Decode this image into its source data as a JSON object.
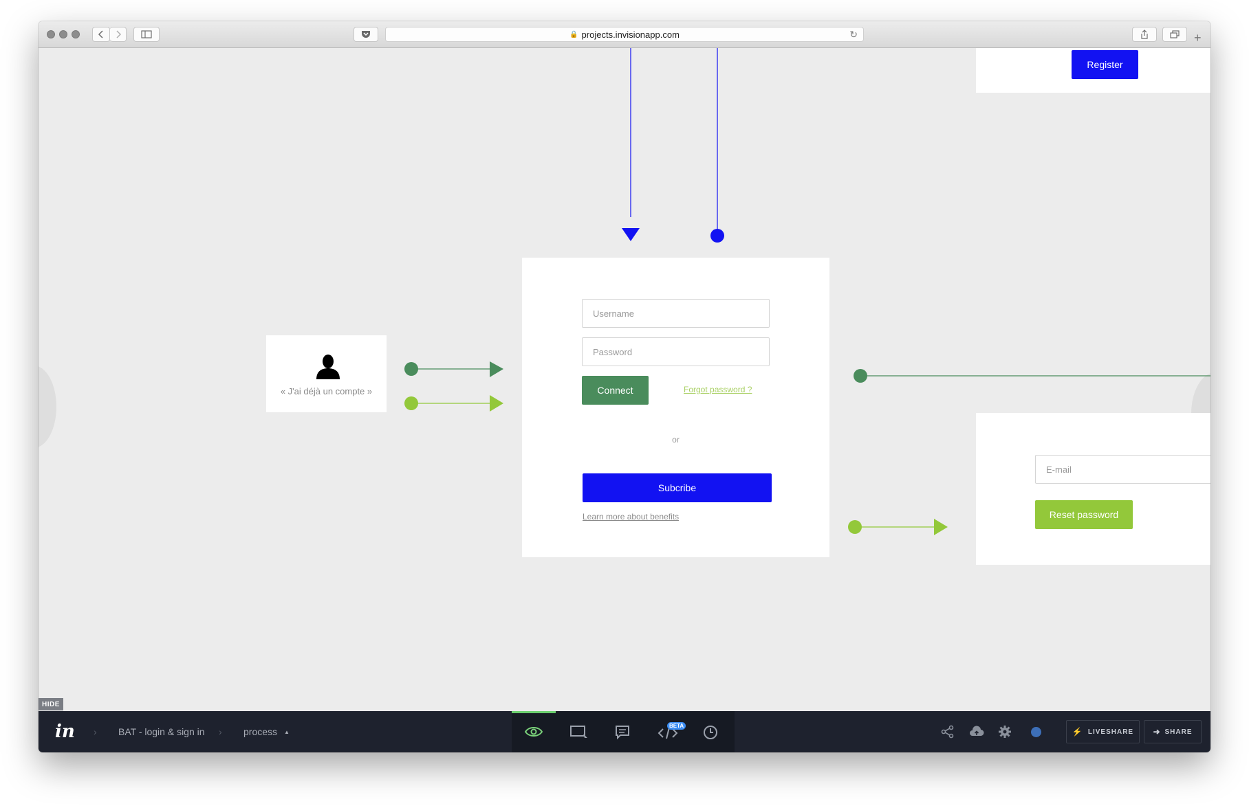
{
  "browser": {
    "url": "projects.invisionapp.com"
  },
  "canvas": {
    "top_card": {
      "register_label": "Register"
    },
    "account_card": {
      "caption": "« J'ai déjà un compte »"
    },
    "login_card": {
      "username_placeholder": "Username",
      "password_placeholder": "Password",
      "connect_label": "Connect",
      "forgot_label": "Forgot password ?",
      "or_label": "or",
      "subscribe_label": "Subcribe",
      "learn_more_label": "Learn more about benefits"
    },
    "reset_card": {
      "email_placeholder": "E-mail",
      "reset_label": "Reset password"
    },
    "colors": {
      "blue": "#1212f2",
      "dark_green": "#4a8c5c",
      "lime": "#93c83a",
      "canvas_bg": "#ececec"
    }
  },
  "toolbar": {
    "hide_label": "HIDE",
    "logo": "in",
    "breadcrumb": [
      "BAT - login & sign in",
      "process"
    ],
    "beta_badge": "BETA",
    "tools": [
      "eye-icon",
      "screen-select-icon",
      "comment-icon",
      "code-icon",
      "clock-icon"
    ],
    "right_icons": [
      "share-network-icon",
      "cloud-upload-icon",
      "gear-icon",
      "status-dot-icon"
    ],
    "liveshare_label": "LIVESHARE",
    "share_label": "SHARE"
  }
}
